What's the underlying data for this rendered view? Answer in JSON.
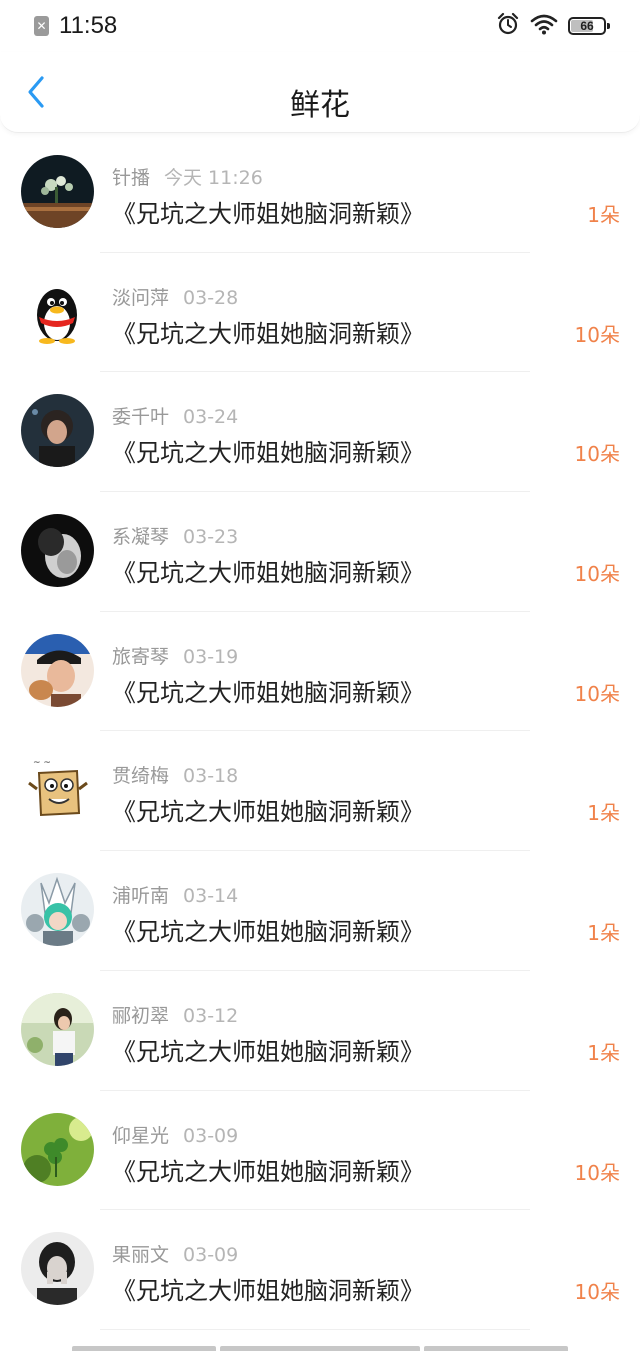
{
  "status_bar": {
    "time": "11:58",
    "battery": "66",
    "battery_level": 0.66,
    "sim_icon": "sim-error-icon",
    "alarm_icon": "alarm-clock-icon",
    "wifi_icon": "wifi-icon"
  },
  "header": {
    "title": "鲜花",
    "back_icon": "chevron-left-icon"
  },
  "colors": {
    "accent_blue": "#2a9af3",
    "amount_orange": "#f0824a",
    "meta_gray": "#999999"
  },
  "items": [
    {
      "name": "针播",
      "date": "今天 11:26",
      "book": "《兄坑之大师姐她脑洞新颖》",
      "amount": "1朵"
    },
    {
      "name": "淡问萍",
      "date": "03-28",
      "book": "《兄坑之大师姐她脑洞新颖》",
      "amount": "10朵"
    },
    {
      "name": "委千叶",
      "date": "03-24",
      "book": "《兄坑之大师姐她脑洞新颖》",
      "amount": "10朵"
    },
    {
      "name": "系凝琴",
      "date": "03-23",
      "book": "《兄坑之大师姐她脑洞新颖》",
      "amount": "10朵"
    },
    {
      "name": "旅寄琴",
      "date": "03-19",
      "book": "《兄坑之大师姐她脑洞新颖》",
      "amount": "10朵"
    },
    {
      "name": "贯绮梅",
      "date": "03-18",
      "book": "《兄坑之大师姐她脑洞新颖》",
      "amount": "1朵"
    },
    {
      "name": "浦听南",
      "date": "03-14",
      "book": "《兄坑之大师姐她脑洞新颖》",
      "amount": "1朵"
    },
    {
      "name": "郦初翠",
      "date": "03-12",
      "book": "《兄坑之大师姐她脑洞新颖》",
      "amount": "1朵"
    },
    {
      "name": "仰星光",
      "date": "03-09",
      "book": "《兄坑之大师姐她脑洞新颖》",
      "amount": "10朵"
    },
    {
      "name": "果丽文",
      "date": "03-09",
      "book": "《兄坑之大师姐她脑洞新颖》",
      "amount": "10朵"
    }
  ]
}
